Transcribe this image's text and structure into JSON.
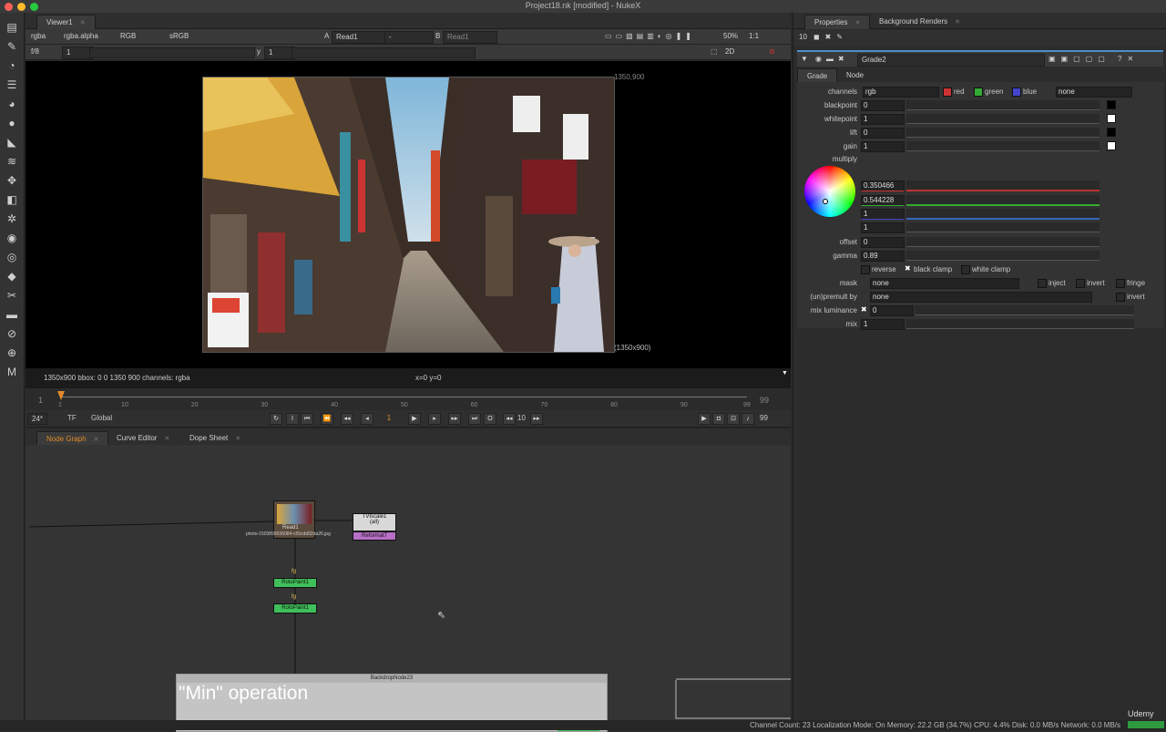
{
  "window": {
    "title": "Project18.nk [modified] - NukeX"
  },
  "viewer": {
    "tab": "Viewer1",
    "channels": "rgba",
    "channel_alpha": "rgba.alpha",
    "display": "RGB",
    "lut": "sRGB",
    "input_a_label": "A",
    "input_a": "Read1",
    "input_a_op": "-",
    "input_b_label": "B",
    "input_b": "Read1",
    "zoom": "50%",
    "ratio": "1:1",
    "fstop": "f/8",
    "frame_field": "1",
    "y_label": "y",
    "y_value": "1",
    "view_mode": "2D",
    "format_top": "1350,900",
    "format_bottom": "(1350x900)",
    "info": "1350x900  bbox: 0 0 1350 900 channels: rgba",
    "coords": "x=0 y=0"
  },
  "timeline": {
    "start": "1",
    "end": "99",
    "ticks": [
      "1",
      "10",
      "20",
      "30",
      "40",
      "50",
      "60",
      "70",
      "80",
      "90",
      "99"
    ],
    "fps": "24*",
    "tf": "TF",
    "global": "Global",
    "current_frame": "1",
    "increment": "10",
    "end_frame": "99"
  },
  "node_graph": {
    "tabs": [
      {
        "label": "Node Graph"
      },
      {
        "label": "Curve Editor"
      },
      {
        "label": "Dope Sheet"
      }
    ],
    "nodes": {
      "read_label": "Read1",
      "read_file": "photo-1503899036084-c55cdd92da26.jpg",
      "tvscale": "TVIscale1",
      "tvscale_sub": "(all)",
      "reformat": "Reformat7",
      "fg1": "fg",
      "fg2": "fg",
      "paint1": "RotoPaint1",
      "paint2": "RotoPaint1",
      "backdrop_title": "BackdropNode23",
      "backdrop_text": "\"Min\" operation"
    }
  },
  "properties": {
    "tabs": [
      {
        "label": "Properties"
      },
      {
        "label": "Background Renders"
      }
    ],
    "max_panels": "10",
    "node_name": "Grade2",
    "sub_tabs": [
      {
        "label": "Grade"
      },
      {
        "label": "Node"
      }
    ],
    "channels_label": "channels",
    "channels_value": "rgb",
    "channel_flags": [
      "red",
      "green",
      "blue"
    ],
    "channel_extra": "none",
    "params": [
      {
        "label": "blackpoint",
        "value": "0"
      },
      {
        "label": "whitepoint",
        "value": "1"
      },
      {
        "label": "lift",
        "value": "0"
      },
      {
        "label": "gain",
        "value": "1"
      }
    ],
    "multiply_label": "multiply",
    "multiply_values": [
      "0.350466",
      "0.544228",
      "1",
      "1"
    ],
    "offset_label": "offset",
    "offset_value": "0",
    "gamma_label": "gamma",
    "gamma_value": "0.89",
    "reverse_label": "reverse",
    "black_clamp_label": "black clamp",
    "white_clamp_label": "white clamp",
    "mask_label": "mask",
    "mask_value": "none",
    "inject_label": "inject",
    "invert_label": "invert",
    "fringe_label": "fringe",
    "unpremult_label": "(un)premult by",
    "unpremult_value": "none",
    "invert2_label": "invert",
    "mix_lum_label": "mix luminance",
    "mix_lum_value": "0",
    "mix_label": "mix",
    "mix_value": "1",
    "slider_ticks": [
      "-1",
      "-0.7",
      "-0.4",
      "-0.1",
      "0.1",
      "0.4",
      "0.7",
      "1"
    ],
    "slider_ticks_pos": [
      "0",
      "0.1",
      "0.4",
      "0.7",
      "1",
      "2",
      "3",
      "4"
    ]
  },
  "status": {
    "text": "Channel Count: 23  Localization Mode: On  Memory: 22.2 GB (34.7%)  CPU: 4.4%  Disk: 0.0 MB/s  Network: 0.0 MB/s",
    "brand": "Udemy"
  },
  "colors": {
    "accent_orange": "#e08a2a",
    "node_green": "#3fbf5a",
    "node_purple": "#b86fc6",
    "backdrop": "#c4c4c4"
  }
}
